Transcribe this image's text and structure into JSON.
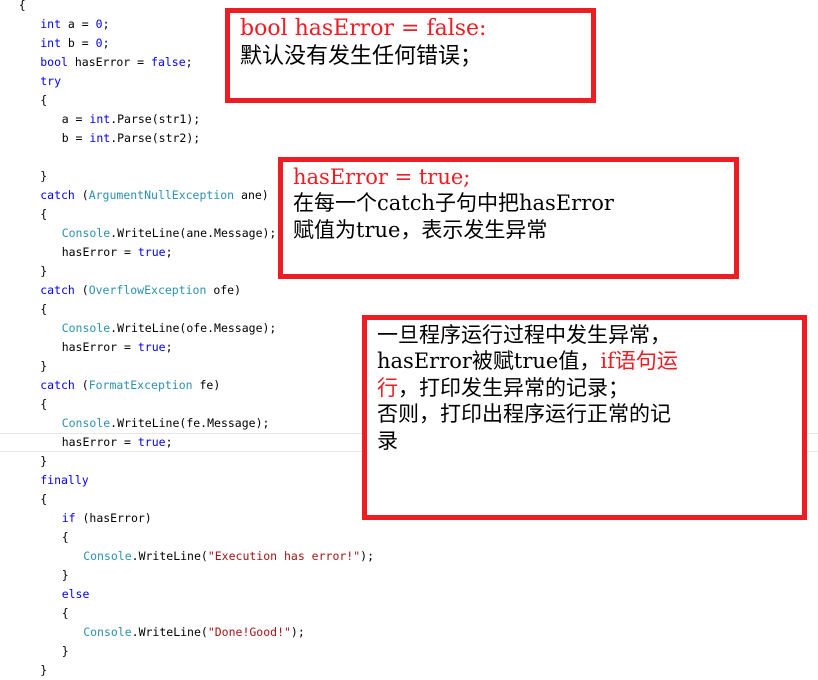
{
  "editor": {
    "language": "csharp",
    "colors": {
      "keyword": "#0000ff",
      "type": "#2b91af",
      "string": "#a31515",
      "plain": "#000000",
      "background": "#ffffff",
      "current_line_border": "#e6e7e8"
    },
    "lines": [
      {
        "indent": 1,
        "tokens": [
          {
            "t": "{",
            "c": "plain"
          }
        ]
      },
      {
        "indent": 3,
        "tokens": [
          {
            "t": "int",
            "c": "kw"
          },
          {
            "t": " a = ",
            "c": "plain"
          },
          {
            "t": "0",
            "c": "num"
          },
          {
            "t": ";",
            "c": "plain"
          }
        ]
      },
      {
        "indent": 3,
        "tokens": [
          {
            "t": "int",
            "c": "kw"
          },
          {
            "t": " b = ",
            "c": "plain"
          },
          {
            "t": "0",
            "c": "num"
          },
          {
            "t": ";",
            "c": "plain"
          }
        ]
      },
      {
        "indent": 3,
        "tokens": [
          {
            "t": "bool",
            "c": "kw"
          },
          {
            "t": " hasError = ",
            "c": "plain"
          },
          {
            "t": "false",
            "c": "kw"
          },
          {
            "t": ";",
            "c": "plain"
          }
        ]
      },
      {
        "indent": 3,
        "tokens": [
          {
            "t": "try",
            "c": "kw"
          }
        ]
      },
      {
        "indent": 3,
        "tokens": [
          {
            "t": "{",
            "c": "plain"
          }
        ]
      },
      {
        "indent": 5,
        "tokens": [
          {
            "t": "a = ",
            "c": "plain"
          },
          {
            "t": "int",
            "c": "kw"
          },
          {
            "t": ".Parse(str1);",
            "c": "plain"
          }
        ]
      },
      {
        "indent": 5,
        "tokens": [
          {
            "t": "b = ",
            "c": "plain"
          },
          {
            "t": "int",
            "c": "kw"
          },
          {
            "t": ".Parse(str2);",
            "c": "plain"
          }
        ]
      },
      {
        "indent": 0,
        "tokens": []
      },
      {
        "indent": 3,
        "tokens": [
          {
            "t": "}",
            "c": "plain"
          }
        ]
      },
      {
        "indent": 3,
        "tokens": [
          {
            "t": "catch",
            "c": "kw"
          },
          {
            "t": " (",
            "c": "plain"
          },
          {
            "t": "ArgumentNullException",
            "c": "type"
          },
          {
            "t": " ane)",
            "c": "plain"
          }
        ]
      },
      {
        "indent": 3,
        "tokens": [
          {
            "t": "{",
            "c": "plain"
          }
        ]
      },
      {
        "indent": 5,
        "tokens": [
          {
            "t": "Console",
            "c": "type"
          },
          {
            "t": ".WriteLine(ane.Message);",
            "c": "plain"
          }
        ]
      },
      {
        "indent": 5,
        "tokens": [
          {
            "t": "hasError = ",
            "c": "plain"
          },
          {
            "t": "true",
            "c": "kw"
          },
          {
            "t": ";",
            "c": "plain"
          }
        ]
      },
      {
        "indent": 3,
        "tokens": [
          {
            "t": "}",
            "c": "plain"
          }
        ]
      },
      {
        "indent": 3,
        "tokens": [
          {
            "t": "catch",
            "c": "kw"
          },
          {
            "t": " (",
            "c": "plain"
          },
          {
            "t": "OverflowException",
            "c": "type"
          },
          {
            "t": " ofe)",
            "c": "plain"
          }
        ]
      },
      {
        "indent": 3,
        "tokens": [
          {
            "t": "{",
            "c": "plain"
          }
        ]
      },
      {
        "indent": 5,
        "tokens": [
          {
            "t": "Console",
            "c": "type"
          },
          {
            "t": ".WriteLine(ofe.Message);",
            "c": "plain"
          }
        ]
      },
      {
        "indent": 5,
        "tokens": [
          {
            "t": "hasError = ",
            "c": "plain"
          },
          {
            "t": "true",
            "c": "kw"
          },
          {
            "t": ";",
            "c": "plain"
          }
        ]
      },
      {
        "indent": 3,
        "tokens": [
          {
            "t": "}",
            "c": "plain"
          }
        ]
      },
      {
        "indent": 3,
        "tokens": [
          {
            "t": "catch",
            "c": "kw"
          },
          {
            "t": " (",
            "c": "plain"
          },
          {
            "t": "FormatException",
            "c": "type"
          },
          {
            "t": " fe)",
            "c": "plain"
          }
        ]
      },
      {
        "indent": 3,
        "tokens": [
          {
            "t": "{",
            "c": "plain"
          }
        ]
      },
      {
        "indent": 5,
        "tokens": [
          {
            "t": "Console",
            "c": "type"
          },
          {
            "t": ".WriteLine(fe.Message);",
            "c": "plain"
          }
        ]
      },
      {
        "indent": 5,
        "highlight": true,
        "tokens": [
          {
            "t": "hasError = ",
            "c": "plain"
          },
          {
            "t": "true",
            "c": "kw"
          },
          {
            "t": ";",
            "c": "plain"
          }
        ]
      },
      {
        "indent": 3,
        "tokens": [
          {
            "t": "}",
            "c": "plain"
          }
        ]
      },
      {
        "indent": 3,
        "tokens": [
          {
            "t": "finally",
            "c": "kw"
          }
        ]
      },
      {
        "indent": 3,
        "tokens": [
          {
            "t": "{",
            "c": "plain"
          }
        ]
      },
      {
        "indent": 5,
        "tokens": [
          {
            "t": "if",
            "c": "kw"
          },
          {
            "t": " (hasError)",
            "c": "plain"
          }
        ]
      },
      {
        "indent": 5,
        "tokens": [
          {
            "t": "{",
            "c": "plain"
          }
        ]
      },
      {
        "indent": 7,
        "tokens": [
          {
            "t": "Console",
            "c": "type"
          },
          {
            "t": ".WriteLine(",
            "c": "plain"
          },
          {
            "t": "\"Execution has error!\"",
            "c": "str"
          },
          {
            "t": ");",
            "c": "plain"
          }
        ]
      },
      {
        "indent": 5,
        "tokens": [
          {
            "t": "}",
            "c": "plain"
          }
        ]
      },
      {
        "indent": 5,
        "tokens": [
          {
            "t": "else",
            "c": "kw"
          }
        ]
      },
      {
        "indent": 5,
        "tokens": [
          {
            "t": "{",
            "c": "plain"
          }
        ]
      },
      {
        "indent": 7,
        "tokens": [
          {
            "t": "Console",
            "c": "type"
          },
          {
            "t": ".WriteLine(",
            "c": "plain"
          },
          {
            "t": "\"Done!Good!\"",
            "c": "str"
          },
          {
            "t": ");",
            "c": "plain"
          }
        ]
      },
      {
        "indent": 5,
        "tokens": [
          {
            "t": "}",
            "c": "plain"
          }
        ]
      },
      {
        "indent": 3,
        "tokens": [
          {
            "t": "}",
            "c": "plain"
          }
        ]
      }
    ]
  },
  "annotations": [
    {
      "id": "annot-1",
      "border_color": "#ee1c23",
      "lines": [
        {
          "segments": [
            {
              "text": "bool hasError = false:",
              "style": "serif-red"
            }
          ]
        },
        {
          "segments": [
            {
              "text": "默认没有发生任何错误；",
              "style": "cjk"
            }
          ]
        }
      ]
    },
    {
      "id": "annot-2",
      "border_color": "#ee1c23",
      "lines": [
        {
          "segments": [
            {
              "text": "hasError = true;",
              "style": "serif-red"
            }
          ]
        },
        {
          "segments": [
            {
              "text": "在每一个",
              "style": "cjk"
            },
            {
              "text": "catch",
              "style": "serif-black"
            },
            {
              "text": "子句中把",
              "style": "cjk"
            },
            {
              "text": "hasError",
              "style": "serif-black"
            }
          ]
        },
        {
          "segments": [
            {
              "text": "赋值为",
              "style": "cjk"
            },
            {
              "text": "true",
              "style": "serif-black"
            },
            {
              "text": "，表示发生异常",
              "style": "cjk"
            }
          ]
        }
      ]
    },
    {
      "id": "annot-3",
      "border_color": "#ee1c23",
      "lines": [
        {
          "segments": [
            {
              "text": "一旦程序运行过程中发生异常，",
              "style": "cjk"
            }
          ]
        },
        {
          "segments": [
            {
              "text": "hasError",
              "style": "serif-black"
            },
            {
              "text": "被赋",
              "style": "cjk"
            },
            {
              "text": "true",
              "style": "serif-black"
            },
            {
              "text": "值，",
              "style": "cjk"
            },
            {
              "text": "if",
              "style": "serif-red"
            },
            {
              "text": "语句运",
              "style": "cjk-red"
            }
          ]
        },
        {
          "segments": [
            {
              "text": "行",
              "style": "cjk-red"
            },
            {
              "text": "，打印发生异常的记录；",
              "style": "cjk"
            }
          ]
        },
        {
          "segments": [
            {
              "text": "否则，打印出程序运行正常的记",
              "style": "cjk"
            }
          ]
        },
        {
          "segments": [
            {
              "text": "录",
              "style": "cjk"
            }
          ]
        }
      ]
    }
  ]
}
